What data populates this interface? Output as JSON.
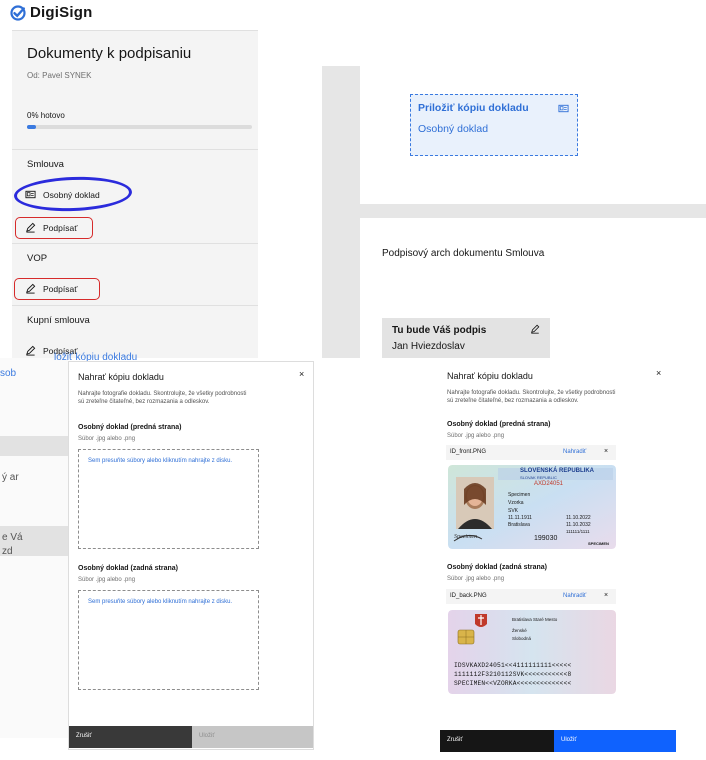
{
  "brand": {
    "name": "DigiSign",
    "color": "#2f6fd6"
  },
  "sidebar": {
    "title": "Dokumenty k podpisaniu",
    "from": "Od: Pavel SYNEK",
    "progress_label": "0% hotovo",
    "progress": 0.04,
    "sections": [
      {
        "name": "Smlouva",
        "items": [
          {
            "label": "Osobný doklad",
            "icon": "id-card-icon"
          },
          {
            "label": "Podpísať",
            "icon": "pen-icon"
          }
        ]
      },
      {
        "name": "VOP",
        "items": [
          {
            "label": "Podpísať",
            "icon": "pen-icon"
          }
        ]
      },
      {
        "name": "Kupní smlouva",
        "items": [
          {
            "label": "Podpísať",
            "icon": "pen-icon"
          }
        ]
      }
    ]
  },
  "document": {
    "attach_title": "Priložiť kópiu dokladu",
    "attach_subtitle": "Osobný doklad",
    "sheet_title": "Podpisový arch dokumentu Smlouva",
    "signature_title": "Tu bude Váš podpis",
    "signer_name": "Jan Hviezdoslav"
  },
  "background_fragments": {
    "f1": "ložiť kópiu dokladu",
    "f2": "sob",
    "f3": "ý ar",
    "f4": "e Vá",
    "f5": "zd"
  },
  "modal_empty": {
    "title": "Nahrať kópiu dokladu",
    "close": "×",
    "description": "Nahrajte fotografie dokladu. Skontrolujte, že všetky podrobnosti sú zreteľne čitateľné, bez rozmazania a odleskov.",
    "front_label": "Osobný doklad (predná strana)",
    "front_hint": "Súbor .jpg alebo .png",
    "front_drop": "Sem presuňte súbory alebo kliknutím nahrajte z disku.",
    "back_label": "Osobný doklad (zadná strana)",
    "back_hint": "Súbor .jpg alebo .png",
    "back_drop": "Sem presuňte súbory alebo kliknutím nahrajte z disku.",
    "cancel": "Zrušiť",
    "submit": "Uložiť"
  },
  "modal_filled": {
    "title": "Nahrať kópiu dokladu",
    "close": "×",
    "description": "Nahrajte fotografie dokladu. Skontrolujte, že všetky podrobnosti sú zreteľne čitateľné, bez rozmazania a odleskov.",
    "front_label": "Osobný doklad (predná strana)",
    "front_hint": "Súbor .jpg alebo .png",
    "front_file": "ID_front.PNG",
    "back_label": "Osobný doklad (zadná strana)",
    "back_hint": "Súbor .jpg alebo .png",
    "back_file": "ID_back.PNG",
    "replace": "Nahradiť",
    "remove": "×",
    "cancel": "Zrušiť",
    "submit": "Uložiť"
  },
  "id_front": {
    "country": "SLOVENSKÁ REPUBLIKA",
    "country_en": "SLOVAK REPUBLIC",
    "number": "AXD24051",
    "surname": "Specimen",
    "given": "Vzorka",
    "nationality": "SVK",
    "birth": "11.11.1911",
    "place": "Bratislava",
    "issue": "11.10.2022",
    "expiry": "11.10.2032",
    "personal_no": "111111/1111",
    "can": "199030",
    "specimen": "SPECIMEN",
    "signature": "Specimen"
  },
  "id_back": {
    "issuer": "Bratislava Staré Mesto",
    "sex": "Ženské",
    "status": "Slobodná",
    "mrz1": "IDSVKAXD24051<<4111111111<<<<<",
    "mrz2": "1111112F3210112SVK<<<<<<<<<<<8",
    "mrz3": "SPECIMEN<<VZORKA<<<<<<<<<<<<<<"
  },
  "colors": {
    "accent": "#2f6fd6",
    "primary_button": "#0f62fe",
    "dark_button": "#393939",
    "annotation_red": "#d62b2b",
    "annotation_blue": "#2b2bdc"
  }
}
